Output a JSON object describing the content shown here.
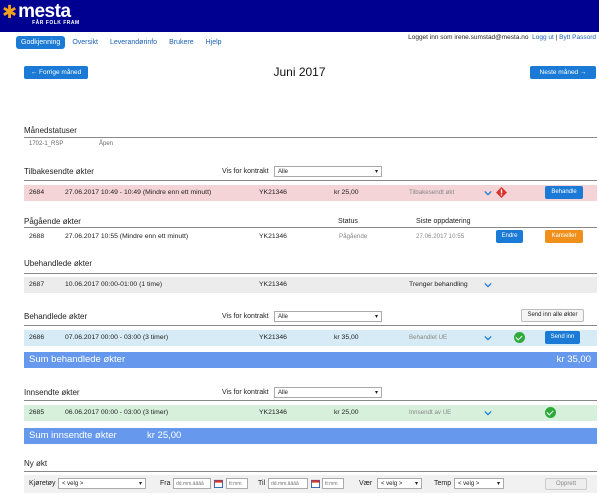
{
  "header": {
    "brand": "mesta",
    "tagline": "FÅR FOLK FRAM"
  },
  "nav": {
    "items": [
      "Godkjenning",
      "Oversikt",
      "Leverandørinfo",
      "Brukere",
      "Hjelp"
    ]
  },
  "user": {
    "logged_in": "Logget inn som irene.sumstad@mesta.no",
    "logout": "Logg ut",
    "change_password": "Bytt Passord"
  },
  "month": {
    "prev": "← Forrige måned",
    "title": "Juni 2017",
    "next": "Neste måned →"
  },
  "statuses": {
    "title": "Månedstatuser",
    "code": "1702-1_RSP",
    "status": "Åpen"
  },
  "returned": {
    "title": "Tilbakesendte økter",
    "filter_label": "Vis for kontrakt",
    "filter_value": "Alle",
    "row": {
      "id": "2684",
      "desc": "27.06.2017 10:49 - 10:49 (Mindre enn ett minutt)",
      "contract": "YK21346",
      "amount": "kr 25,00",
      "status": "Tilbakesendt økt",
      "action": "Behandle"
    }
  },
  "ongoing": {
    "title": "Pågående økter",
    "col_status": "Status",
    "col_updated": "Siste oppdatering",
    "row": {
      "id": "2688",
      "desc": "27.06.2017 10:55 (Mindre enn ett minutt)",
      "contract": "YK21346",
      "status": "Pågående",
      "updated": "27.06.2017 10:55",
      "edit": "Endre",
      "cancel": "Kanseller"
    }
  },
  "unhandled": {
    "title": "Ubehandlede økter",
    "row": {
      "id": "2687",
      "desc": "10.06.2017 00:00-01:00 (1 time)",
      "contract": "YK21346",
      "status": "Trenger behandling"
    }
  },
  "handled": {
    "title": "Behandlede økter",
    "filter_label": "Vis for kontrakt",
    "filter_value": "Alle",
    "send_all": "Send inn alle økter",
    "row": {
      "id": "2686",
      "desc": "07.06.2017 00:00 - 03:00 (3 timer)",
      "contract": "YK21346",
      "amount": "kr 35,00",
      "status": "Behandlet UE",
      "action": "Send inn"
    },
    "sum_label": "Sum behandlede økter",
    "sum_value": "kr 35,00"
  },
  "submitted": {
    "title": "Innsendte økter",
    "filter_label": "Vis for kontrakt",
    "filter_value": "Alle",
    "row": {
      "id": "2685",
      "desc": "06.06.2017 00:00 - 03:00 (3 timer)",
      "contract": "YK21346",
      "amount": "kr 25,00",
      "status": "Innsendt av UE"
    },
    "sum_label": "Sum innsendte økter",
    "sum_value": "kr 25,00"
  },
  "new_session": {
    "title": "Ny økt",
    "vehicle_label": "Kjøretøy",
    "vehicle_value": "< velg >",
    "from_label": "Fra",
    "from_date_ph": "dd.mm.åååå",
    "from_time_ph": "tt:mm",
    "to_label": "Til",
    "to_date_ph": "dd.mm.åååå",
    "to_time_ph": "tt:mm",
    "weather_label": "Vær",
    "weather_value": "< velg >",
    "temp_label": "Temp",
    "temp_value": "< velg >",
    "create": "Opprett"
  },
  "colors": {
    "header": "#000090",
    "accent": "#1a7ad6",
    "sum_bar": "#6699ee",
    "returned_row": "#f4d4d6",
    "handled_row": "#d6ebf5",
    "submitted_row": "#d6f0dc"
  }
}
